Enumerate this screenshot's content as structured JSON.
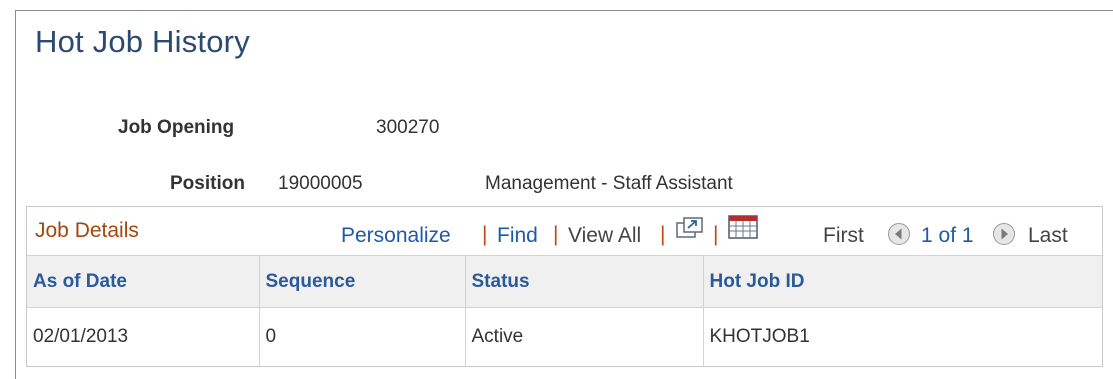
{
  "page": {
    "title": "Hot Job History"
  },
  "header": {
    "job_opening_label": "Job Opening",
    "job_opening_value": "300270",
    "position_label": "Position",
    "position_value": "19000005",
    "position_desc": "Management - Staff Assistant"
  },
  "grid": {
    "title": "Job Details",
    "personalize": "Personalize",
    "find": "Find",
    "view_all": "View All",
    "separator": "|",
    "first": "First",
    "page_info": "1 of 1",
    "last": "Last",
    "columns": [
      "As of Date",
      "Sequence",
      "Status",
      "Hot Job ID"
    ],
    "rows": [
      [
        "02/01/2013",
        "0",
        "Active",
        "KHOTJOB1"
      ]
    ],
    "icons": {
      "new_window": "new-window-icon",
      "download": "download-spreadsheet-icon",
      "prev": "previous-arrow-icon",
      "next": "next-arrow-icon"
    }
  }
}
